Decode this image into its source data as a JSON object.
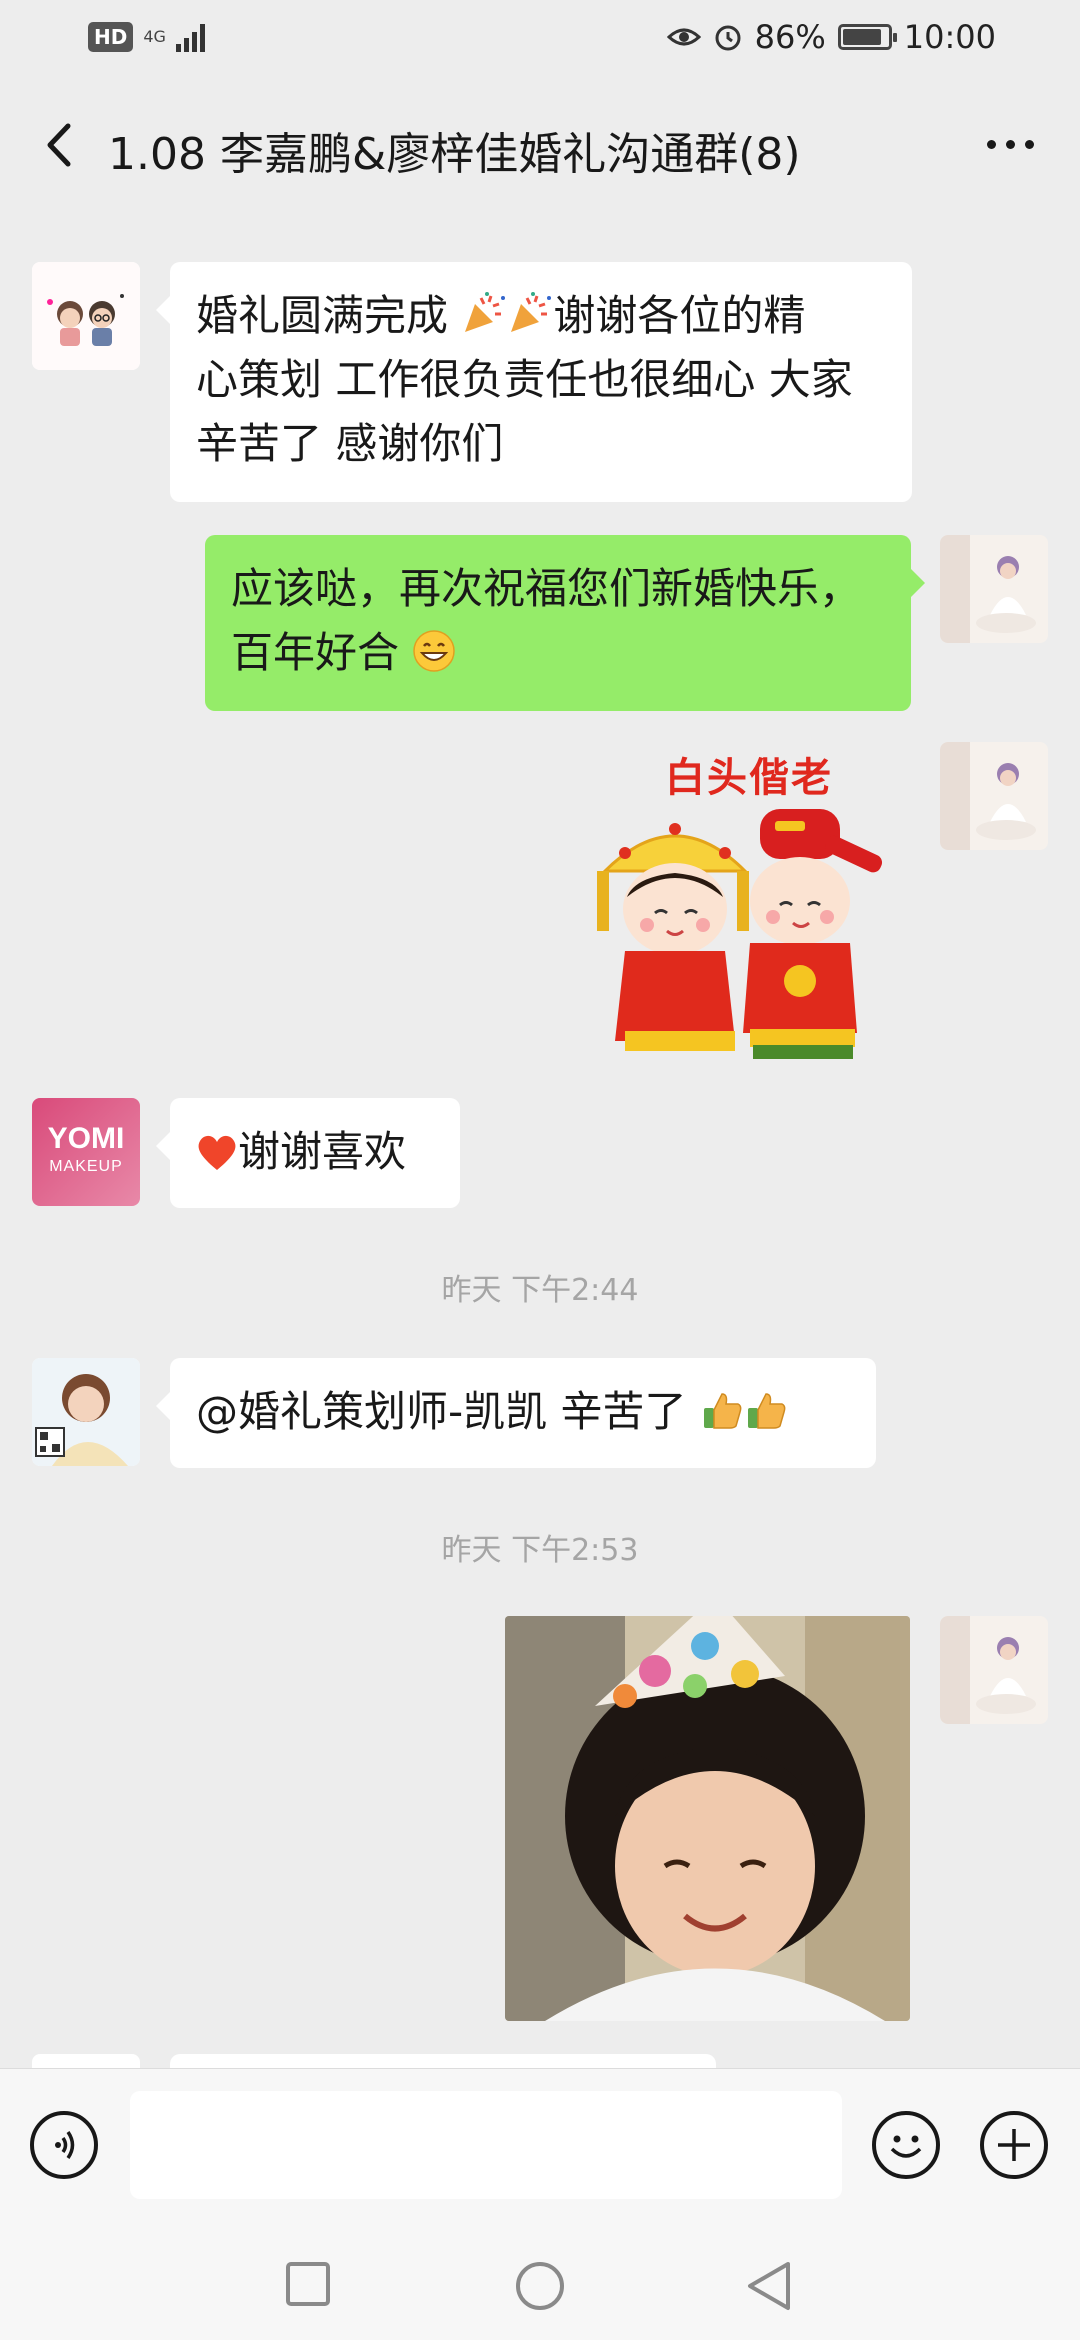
{
  "status_bar": {
    "hd": "HD",
    "network": "4G",
    "battery": "86%",
    "battery_level": 0.86,
    "time": "10:00"
  },
  "header": {
    "title": "1.08 李嘉鹏&廖梓佳婚礼沟通群(8)",
    "back_icon": "chevron-left-icon",
    "more_icon": "more-dots-icon"
  },
  "messages": [
    {
      "side": "left",
      "type": "text",
      "text_lines": [
        "婚礼圆满完成",
        "谢谢各位的精",
        "心策划 工作很负责任也很细心 大家",
        "辛苦了 感谢你们"
      ]
    },
    {
      "side": "right",
      "type": "text",
      "text_lines": [
        "应该哒，再次祝福您们新婚快乐，",
        "百年好合"
      ]
    },
    {
      "side": "right",
      "type": "sticker",
      "caption": "白头偕老"
    },
    {
      "side": "left",
      "type": "text",
      "text": "谢谢喜欢",
      "avatar_text_1": "YOMI",
      "avatar_text_2": "MAKEUP"
    },
    {
      "side": "left",
      "type": "text",
      "text": "@婚礼策划师-凯凯  辛苦了"
    },
    {
      "side": "right",
      "type": "image"
    }
  ],
  "timestamps": [
    "昨天 下午2:44",
    "昨天 下午2:53"
  ],
  "input_bar": {
    "voice_icon": "voice-icon",
    "emoji_icon": "emoji-icon",
    "plus_icon": "plus-icon",
    "text": ""
  },
  "nav": {
    "recent_icon": "square-icon",
    "home_icon": "circle-icon",
    "back_icon": "triangle-back-icon"
  },
  "colors": {
    "background": "#ededed",
    "green_bubble": "#95ec69",
    "white_bubble": "#ffffff"
  }
}
